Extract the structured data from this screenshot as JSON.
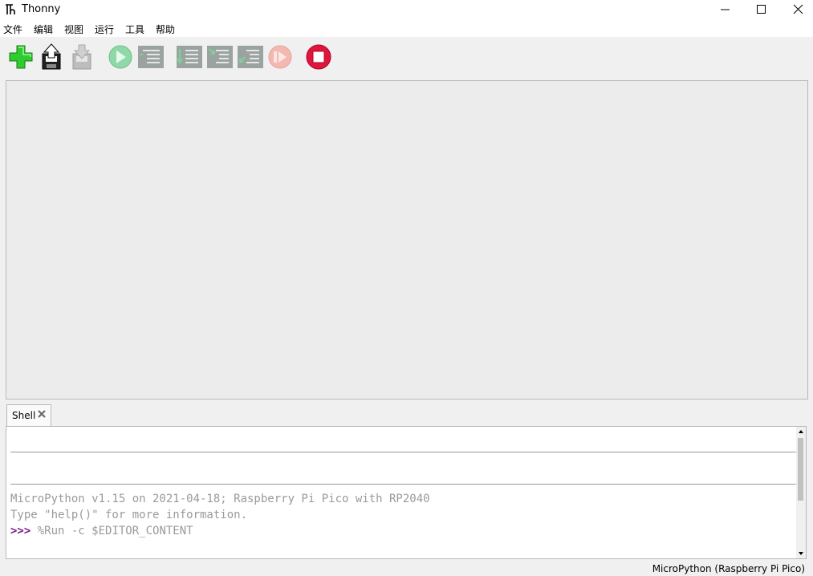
{
  "window": {
    "title": "Thonny"
  },
  "menu": {
    "items": [
      {
        "label": "文件"
      },
      {
        "label": "编辑"
      },
      {
        "label": "视图"
      },
      {
        "label": "运行"
      },
      {
        "label": "工具"
      },
      {
        "label": "帮助"
      }
    ]
  },
  "toolbar": {
    "buttons": [
      {
        "icon": "new-file-icon"
      },
      {
        "icon": "load-file-icon"
      },
      {
        "icon": "save-file-icon"
      },
      {
        "icon": "run-icon"
      },
      {
        "icon": "debug-icon"
      },
      {
        "icon": "step-over-icon"
      },
      {
        "icon": "step-into-icon"
      },
      {
        "icon": "step-out-icon"
      },
      {
        "icon": "resume-icon"
      },
      {
        "icon": "stop-icon"
      }
    ]
  },
  "shell": {
    "tab_label": "Shell",
    "lines": [
      "MicroPython v1.15 on 2021-04-18; Raspberry Pi Pico with RP2040",
      "Type \"help()\" for more information."
    ],
    "prompt": ">>>",
    "command": "%Run -c $EDITOR_CONTENT"
  },
  "status": {
    "interpreter": "MicroPython (Raspberry Pi Pico)"
  },
  "colors": {
    "prompt": "#7a1f8a",
    "stop": "#e0143c",
    "run": "#6fcf8f",
    "new": "#2ecc2e"
  }
}
